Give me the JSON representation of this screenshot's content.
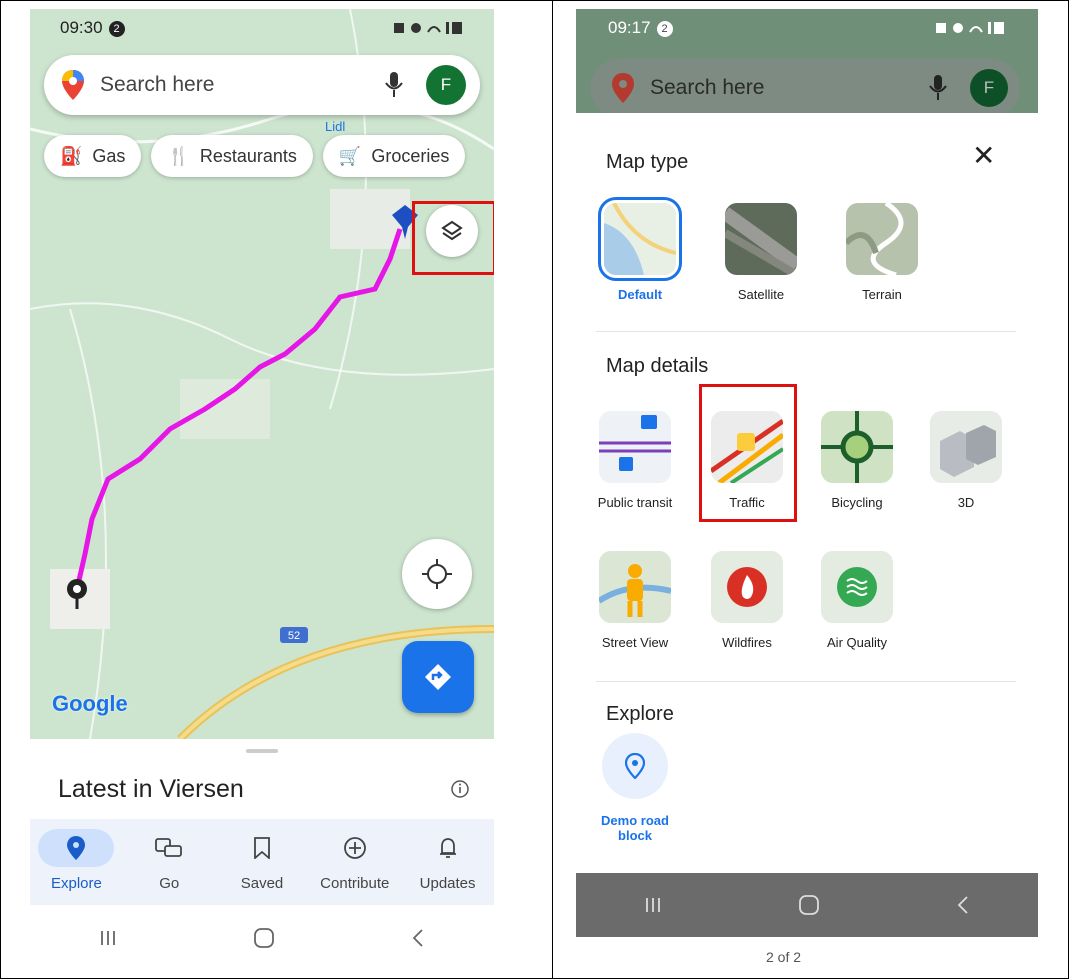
{
  "left": {
    "status_time": "09:30",
    "status_badge": "2",
    "search_placeholder": "Search here",
    "avatar_letter": "F",
    "chips": [
      "Gas",
      "Restaurants",
      "Groceries"
    ],
    "map_label_lidl": "Lidl",
    "road_label": "52",
    "google_logo": "Google",
    "sheet_title": "Latest in Viersen",
    "tabs": [
      "Explore",
      "Go",
      "Saved",
      "Contribute",
      "Updates"
    ],
    "active_tab": "Explore",
    "route_color": "#e617e6",
    "accent": "#1a73e8"
  },
  "right": {
    "status_time": "09:17",
    "status_badge": "2",
    "search_placeholder": "Search here",
    "avatar_letter": "F",
    "map_type_title": "Map type",
    "map_types": [
      "Default",
      "Satellite",
      "Terrain"
    ],
    "selected_map_type": "Default",
    "map_details_title": "Map details",
    "map_details": [
      "Public transit",
      "Traffic",
      "Bicycling",
      "3D",
      "Street View",
      "Wildfires",
      "Air Quality"
    ],
    "explore_title": "Explore",
    "explore_item": "Demo road block",
    "page_indicator": "2 of 2"
  },
  "highlight_color": "#e01010"
}
